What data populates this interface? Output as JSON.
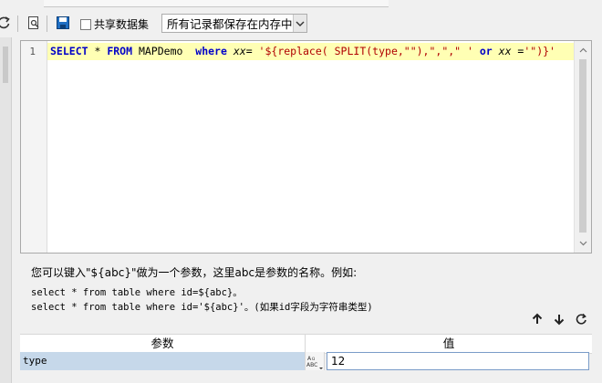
{
  "toolbar": {
    "refresh_icon": "refresh-icon",
    "preview_icon": "preview-icon",
    "save_icon": "save-icon",
    "shared_dataset_label": "共享数据集",
    "cache_select_value": "所有记录都保存在内存中"
  },
  "editor": {
    "line_number": "1",
    "sql": {
      "kw_select": "SELECT",
      "star": " * ",
      "kw_from": "FROM",
      "table": " MAPDemo  ",
      "kw_where": "where",
      "field": " xx",
      "eq": "= ",
      "str_open": "'${replace( SPLIT(type,\"\"),\",\",\" ' ",
      "kw_or": "or",
      "field2": " xx =",
      "str_close": "'\")}'"
    }
  },
  "help": {
    "line1": "您可以键入\"${abc}\"做为一个参数，这里abc是参数的名称。例如:",
    "line2": "select * from table where id=${abc}。",
    "line3": "select * from table where id='${abc}'。(如果id字段为字符串类型)"
  },
  "params": {
    "header_name": "参数",
    "header_value": "值",
    "rows": [
      {
        "name": "type",
        "value": "12"
      }
    ]
  },
  "colors": {
    "keyword": "#0000c8",
    "string": "#b00000",
    "line_highlight": "#ffffb4",
    "row_selected": "#c6d8ea"
  }
}
